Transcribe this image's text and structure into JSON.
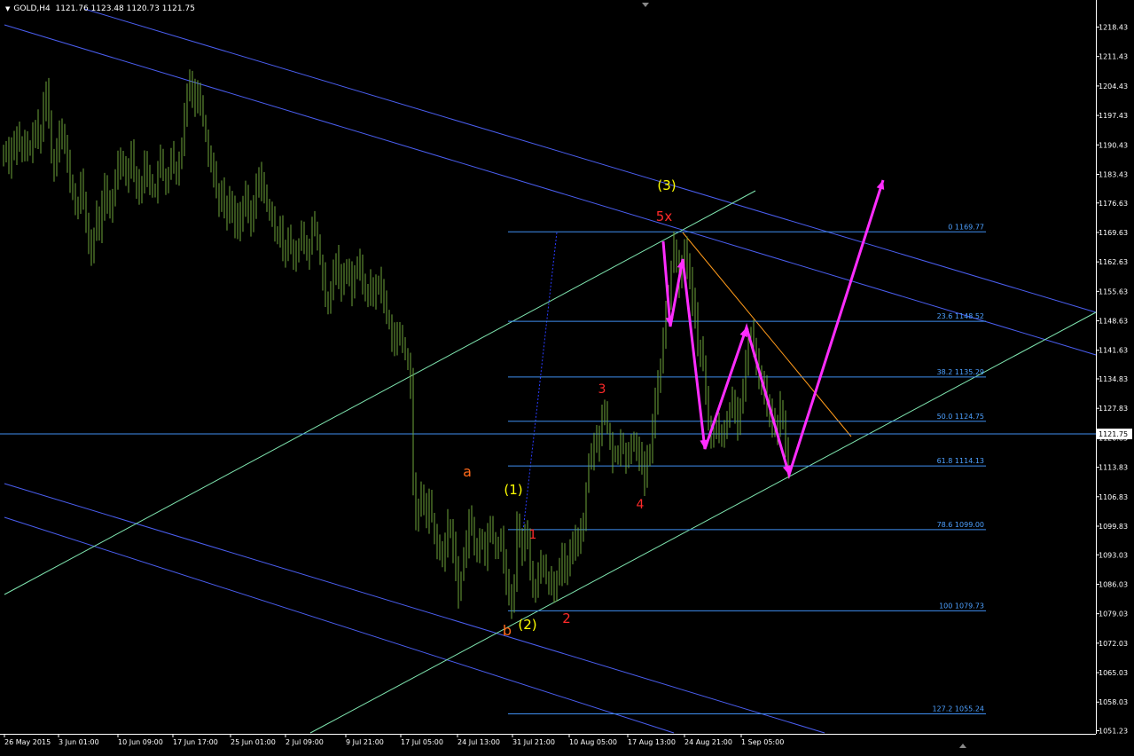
{
  "header": {
    "symbol": "GOLD,H4",
    "ohlc": "1121.76 1123.48 1120.73 1121.75"
  },
  "chart_data": {
    "type": "candlestick",
    "symbol": "GOLD",
    "timeframe": "H4",
    "ylim": [
      1048.0,
      1222.0
    ],
    "y_ticks": [
      "1218.43",
      "1211.43",
      "1204.43",
      "1197.43",
      "1190.43",
      "1183.43",
      "1176.63",
      "1169.63",
      "1162.63",
      "1155.63",
      "1148.63",
      "1141.63",
      "1134.83",
      "1127.83",
      "1120.83",
      "1113.83",
      "1106.83",
      "1099.83",
      "1093.03",
      "1086.03",
      "1079.03",
      "1072.03",
      "1065.03",
      "1058.03",
      "1051.23"
    ],
    "x_ticks": [
      "26 May 2015",
      "3 Jun 01:00",
      "10 Jun 09:00",
      "17 Jun 17:00",
      "25 Jun 01:00",
      "2 Jul 09:00",
      "9 Jul 21:00",
      "17 Jul 05:00",
      "24 Jul 13:00",
      "31 Jul 21:00",
      "10 Aug 05:00",
      "17 Aug 13:00",
      "24 Aug 21:00",
      "1 Sep 05:00"
    ],
    "current_price": "1121.75",
    "price_path": [
      [
        0,
        1188
      ],
      [
        3,
        1190
      ],
      [
        6,
        1186
      ],
      [
        9,
        1191
      ],
      [
        12,
        1189
      ],
      [
        15,
        1193
      ],
      [
        18,
        1190
      ],
      [
        21,
        1188
      ],
      [
        24,
        1191
      ],
      [
        27,
        1189
      ],
      [
        30,
        1190
      ],
      [
        33,
        1192
      ],
      [
        36,
        1195
      ],
      [
        39,
        1191
      ],
      [
        42,
        1193
      ],
      [
        45,
        1200
      ],
      [
        48,
        1204
      ],
      [
        51,
        1196
      ],
      [
        54,
        1188
      ],
      [
        57,
        1185
      ],
      [
        60,
        1190
      ],
      [
        63,
        1195
      ],
      [
        66,
        1193
      ],
      [
        69,
        1190
      ],
      [
        72,
        1186
      ],
      [
        75,
        1182
      ],
      [
        78,
        1179
      ],
      [
        81,
        1175
      ],
      [
        84,
        1177
      ],
      [
        87,
        1181
      ],
      [
        90,
        1177
      ],
      [
        93,
        1172
      ],
      [
        96,
        1168
      ],
      [
        99,
        1164
      ],
      [
        102,
        1169
      ],
      [
        105,
        1174
      ],
      [
        108,
        1171
      ],
      [
        111,
        1176
      ],
      [
        114,
        1180
      ],
      [
        117,
        1177
      ],
      [
        120,
        1174
      ],
      [
        123,
        1178
      ],
      [
        126,
        1183
      ],
      [
        129,
        1186
      ],
      [
        132,
        1188
      ],
      [
        135,
        1185
      ],
      [
        138,
        1183
      ],
      [
        141,
        1186
      ],
      [
        144,
        1189
      ],
      [
        147,
        1184
      ],
      [
        150,
        1181
      ],
      [
        153,
        1178
      ],
      [
        156,
        1182
      ],
      [
        159,
        1186
      ],
      [
        162,
        1184
      ],
      [
        165,
        1182
      ],
      [
        168,
        1179
      ],
      [
        171,
        1180
      ],
      [
        174,
        1184
      ],
      [
        177,
        1187
      ],
      [
        180,
        1183
      ],
      [
        183,
        1181
      ],
      [
        186,
        1184
      ],
      [
        189,
        1188
      ],
      [
        192,
        1185
      ],
      [
        195,
        1182
      ],
      [
        198,
        1186
      ],
      [
        201,
        1190
      ],
      [
        204,
        1198
      ],
      [
        207,
        1204
      ],
      [
        210,
        1206
      ],
      [
        213,
        1203
      ],
      [
        216,
        1200
      ],
      [
        219,
        1204
      ],
      [
        222,
        1201
      ],
      [
        225,
        1196
      ],
      [
        228,
        1193
      ],
      [
        231,
        1188
      ],
      [
        234,
        1186
      ],
      [
        237,
        1184
      ],
      [
        240,
        1180
      ],
      [
        243,
        1177
      ],
      [
        246,
        1179
      ],
      [
        249,
        1176
      ],
      [
        252,
        1174
      ],
      [
        255,
        1177
      ],
      [
        258,
        1175
      ],
      [
        261,
        1172
      ],
      [
        264,
        1174
      ],
      [
        267,
        1171
      ],
      [
        270,
        1176
      ],
      [
        273,
        1178
      ],
      [
        276,
        1174
      ],
      [
        279,
        1172
      ],
      [
        282,
        1176
      ],
      [
        285,
        1180
      ],
      [
        288,
        1184
      ],
      [
        291,
        1181
      ],
      [
        294,
        1178
      ],
      [
        297,
        1176
      ],
      [
        300,
        1175
      ],
      [
        303,
        1172
      ],
      [
        306,
        1170
      ],
      [
        309,
        1169
      ],
      [
        312,
        1172
      ],
      [
        315,
        1166
      ],
      [
        318,
        1165
      ],
      [
        321,
        1168
      ],
      [
        324,
        1166
      ],
      [
        327,
        1163
      ],
      [
        330,
        1164
      ],
      [
        333,
        1167
      ],
      [
        336,
        1170
      ],
      [
        339,
        1167
      ],
      [
        342,
        1164
      ],
      [
        345,
        1167
      ],
      [
        348,
        1171
      ],
      [
        351,
        1170
      ],
      [
        354,
        1167
      ],
      [
        357,
        1163
      ],
      [
        360,
        1159
      ],
      [
        363,
        1153
      ],
      [
        366,
        1152
      ],
      [
        369,
        1156
      ],
      [
        372,
        1160
      ],
      [
        375,
        1163
      ],
      [
        378,
        1160
      ],
      [
        381,
        1157
      ],
      [
        384,
        1159
      ],
      [
        387,
        1162
      ],
      [
        390,
        1160
      ],
      [
        393,
        1156
      ],
      [
        396,
        1160
      ],
      [
        399,
        1162
      ],
      [
        402,
        1161
      ],
      [
        405,
        1158
      ],
      [
        408,
        1156
      ],
      [
        411,
        1155
      ],
      [
        414,
        1157
      ],
      [
        417,
        1154
      ],
      [
        420,
        1157
      ],
      [
        423,
        1158
      ],
      [
        426,
        1156
      ],
      [
        429,
        1153
      ],
      [
        432,
        1150
      ],
      [
        435,
        1148
      ],
      [
        438,
        1145
      ],
      [
        441,
        1144
      ],
      [
        444,
        1146
      ],
      [
        447,
        1144
      ],
      [
        450,
        1143
      ],
      [
        453,
        1141
      ],
      [
        456,
        1139
      ],
      [
        459,
        1134
      ],
      [
        462,
        1110
      ],
      [
        465,
        1100
      ],
      [
        468,
        1104
      ],
      [
        471,
        1108
      ],
      [
        474,
        1105
      ],
      [
        477,
        1101
      ],
      [
        480,
        1106
      ],
      [
        483,
        1102
      ],
      [
        486,
        1098
      ],
      [
        489,
        1093
      ],
      [
        492,
        1095
      ],
      [
        495,
        1092
      ],
      [
        498,
        1096
      ],
      [
        501,
        1100
      ],
      [
        504,
        1098
      ],
      [
        507,
        1095
      ],
      [
        510,
        1090
      ],
      [
        513,
        1084
      ],
      [
        516,
        1088
      ],
      [
        519,
        1092
      ],
      [
        522,
        1096
      ],
      [
        525,
        1102
      ],
      [
        528,
        1099
      ],
      [
        531,
        1096
      ],
      [
        534,
        1093
      ],
      [
        537,
        1098
      ],
      [
        540,
        1096
      ],
      [
        543,
        1093
      ],
      [
        546,
        1098
      ],
      [
        549,
        1101
      ],
      [
        552,
        1097
      ],
      [
        555,
        1094
      ],
      [
        558,
        1096
      ],
      [
        561,
        1098
      ],
      [
        564,
        1092
      ],
      [
        567,
        1086
      ],
      [
        570,
        1084
      ],
      [
        573,
        1081
      ],
      [
        576,
        1086
      ],
      [
        579,
        1100
      ],
      [
        582,
        1097
      ],
      [
        585,
        1094
      ],
      [
        588,
        1099
      ],
      [
        591,
        1096
      ],
      [
        594,
        1090
      ],
      [
        597,
        1086
      ],
      [
        600,
        1084
      ],
      [
        603,
        1088
      ],
      [
        606,
        1092
      ],
      [
        609,
        1090
      ],
      [
        612,
        1088
      ],
      [
        615,
        1086
      ],
      [
        618,
        1088
      ],
      [
        621,
        1085
      ],
      [
        624,
        1087
      ],
      [
        627,
        1089
      ],
      [
        630,
        1092
      ],
      [
        633,
        1088
      ],
      [
        636,
        1091
      ],
      [
        639,
        1093
      ],
      [
        642,
        1095
      ],
      [
        645,
        1098
      ],
      [
        648,
        1096
      ],
      [
        651,
        1099
      ],
      [
        654,
        1101
      ],
      [
        657,
        1109
      ],
      [
        660,
        1115
      ],
      [
        663,
        1117
      ],
      [
        666,
        1121
      ],
      [
        669,
        1119
      ],
      [
        672,
        1122
      ],
      [
        675,
        1127
      ],
      [
        678,
        1126
      ],
      [
        681,
        1123
      ],
      [
        684,
        1119
      ],
      [
        687,
        1116
      ],
      [
        690,
        1116
      ],
      [
        693,
        1118
      ],
      [
        696,
        1121
      ],
      [
        699,
        1118
      ],
      [
        702,
        1115
      ],
      [
        705,
        1117
      ],
      [
        708,
        1120
      ],
      [
        711,
        1121
      ],
      [
        714,
        1118
      ],
      [
        717,
        1116
      ],
      [
        720,
        1114
      ],
      [
        723,
        1110
      ],
      [
        726,
        1116
      ],
      [
        729,
        1118
      ],
      [
        732,
        1124
      ],
      [
        735,
        1130
      ],
      [
        738,
        1133
      ],
      [
        741,
        1138
      ],
      [
        744,
        1144
      ],
      [
        747,
        1150
      ],
      [
        750,
        1155
      ],
      [
        753,
        1161
      ],
      [
        756,
        1166
      ],
      [
        759,
        1162
      ],
      [
        762,
        1158
      ],
      [
        765,
        1161
      ],
      [
        768,
        1166
      ],
      [
        771,
        1162
      ],
      [
        774,
        1158
      ],
      [
        777,
        1153
      ],
      [
        780,
        1150
      ],
      [
        783,
        1143
      ],
      [
        786,
        1141
      ],
      [
        789,
        1138
      ],
      [
        792,
        1131
      ],
      [
        795,
        1124
      ],
      [
        798,
        1120
      ],
      [
        801,
        1122
      ],
      [
        804,
        1125
      ],
      [
        807,
        1122
      ],
      [
        810,
        1120
      ],
      [
        813,
        1122
      ],
      [
        816,
        1126
      ],
      [
        819,
        1128
      ],
      [
        822,
        1131
      ],
      [
        825,
        1127
      ],
      [
        828,
        1124
      ],
      [
        831,
        1128
      ],
      [
        834,
        1132
      ],
      [
        837,
        1138
      ],
      [
        840,
        1145
      ],
      [
        843,
        1146
      ],
      [
        846,
        1143
      ],
      [
        849,
        1139
      ],
      [
        852,
        1136
      ],
      [
        855,
        1134
      ],
      [
        858,
        1132
      ],
      [
        861,
        1129
      ],
      [
        864,
        1127
      ],
      [
        867,
        1124
      ],
      [
        870,
        1122
      ],
      [
        873,
        1125
      ],
      [
        876,
        1128
      ],
      [
        879,
        1124
      ],
      [
        882,
        1118
      ],
      [
        885,
        1115
      ]
    ],
    "fibonacci": [
      {
        "label": "0 1169.77",
        "price": 1169.77
      },
      {
        "label": "23.6 1148.52",
        "price": 1148.52
      },
      {
        "label": "38.2 1135.29",
        "price": 1135.29
      },
      {
        "label": "50.0 1124.75",
        "price": 1124.75
      },
      {
        "label": "61.8 1114.13",
        "price": 1114.13
      },
      {
        "label": "78.6 1099.00",
        "price": 1099.0
      },
      {
        "label": "100 1079.73",
        "price": 1079.73
      },
      {
        "label": "127.2 1055.24",
        "price": 1055.24
      }
    ],
    "wave_labels": [
      {
        "text": "(3)",
        "color": "#ffff00"
      },
      {
        "text": "5x",
        "color": "#ff2a2a"
      },
      {
        "text": "3",
        "color": "#ff2a2a"
      },
      {
        "text": "4",
        "color": "#ff2a2a"
      },
      {
        "text": "a",
        "color": "#ff6a1a"
      },
      {
        "text": "(1)",
        "color": "#ffff00"
      },
      {
        "text": "1",
        "color": "#ff2a2a"
      },
      {
        "text": "2",
        "color": "#ff2a2a"
      },
      {
        "text": "b",
        "color": "#ff6a1a"
      },
      {
        "text": "(2)",
        "color": "#ffff00"
      }
    ],
    "colors": {
      "background": "#000000",
      "candles": "#6ea33a",
      "trend_channel": "#4a5ef0",
      "support_line": "#7fe6b0",
      "fib_lines": "#3f8ef0",
      "fib_text": "#4da0ff",
      "projection": "#ff2dff",
      "orange_line": "#ff9a1a",
      "axis_text": "#ffffff"
    },
    "grid": false
  }
}
